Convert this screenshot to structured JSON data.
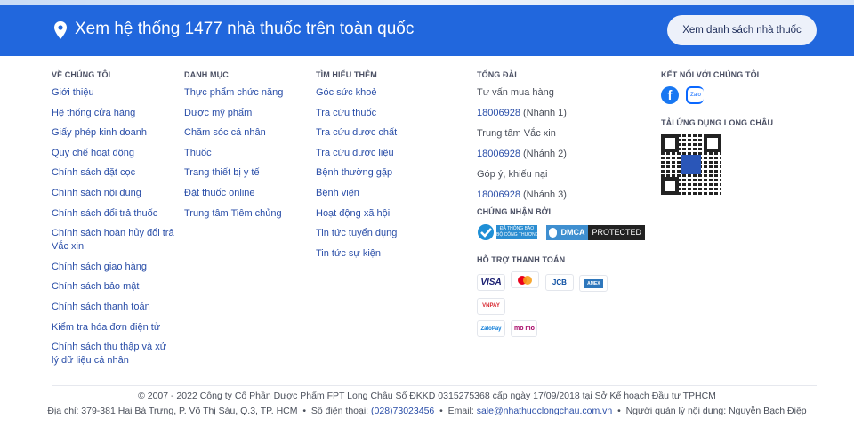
{
  "banner": {
    "title": "Xem hệ thống 1477 nhà thuốc trên toàn quốc",
    "button": "Xem danh sách nhà thuốc"
  },
  "col1": {
    "title": "Về chúng tôi",
    "items": [
      "Giới thiệu",
      "Hệ thống cửa hàng",
      "Giấy phép kinh doanh",
      "Quy chế hoạt động",
      "Chính sách đặt cọc",
      "Chính sách nội dung",
      "Chính sách đổi trả thuốc",
      "Chính sách hoàn hủy đổi trả Vắc xin",
      "Chính sách giao hàng",
      "Chính sách bảo mật",
      "Chính sách thanh toán",
      "Kiểm tra hóa đơn điện tử",
      "Chính sách thu thập và xử lý dữ liệu cá nhân"
    ]
  },
  "col2": {
    "title": "Danh mục",
    "items": [
      "Thực phẩm chức năng",
      "Dược mỹ phẩm",
      "Chăm sóc cá nhân",
      "Thuốc",
      "Trang thiết bị y tế",
      "Đặt thuốc online",
      "Trung tâm Tiêm chủng"
    ]
  },
  "col3": {
    "title": "Tìm hiểu thêm",
    "items": [
      "Góc sức khoẻ",
      "Tra cứu thuốc",
      "Tra cứu dược chất",
      "Tra cứu dược liệu",
      "Bệnh thường gặp",
      "Bệnh viện",
      "Hoạt động xã hội",
      "Tin tức tuyển dụng",
      "Tin tức sự kiện"
    ]
  },
  "col4": {
    "title": "Tổng đài",
    "groups": [
      {
        "label": "Tư vấn mua hàng",
        "phone": "18006928",
        "branch": "(Nhánh 1)"
      },
      {
        "label": "Trung tâm Vắc xin",
        "phone": "18006928",
        "branch": "(Nhánh 2)"
      },
      {
        "label": "Góp ý, khiếu nại",
        "phone": "18006928",
        "branch": "(Nhánh 3)"
      }
    ],
    "cert_title": "Chứng nhận bởi",
    "cert1": "ĐÃ THÔNG BÁO",
    "cert1_sub": "BỘ CÔNG THƯƠNG",
    "dmca": "DMCA",
    "dmca_protected": "PROTECTED",
    "pay_title": "Hỗ trợ thanh toán",
    "pay": [
      "VISA",
      "JCB",
      "AMEX",
      "VNPAY",
      "ZaloPay",
      "mo mo"
    ]
  },
  "col5": {
    "title": "Kết nối với chúng tôi",
    "zalo": "Zalo",
    "app_title": "Tải ứng dụng Long Châu"
  },
  "footer": {
    "copyright": "© 2007 - 2022 Công ty Cổ Phần Dược Phẩm FPT Long Châu Số ĐKKD 0315275368 cấp ngày 17/09/2018 tại Sở Kế hoạch Đầu tư TPHCM",
    "address": "Địa chỉ: 379-381 Hai Bà Trưng, P. Võ Thị Sáu, Q.3, TP. HCM",
    "phone_label": "Số điện thoại:",
    "phone": "(028)73023456",
    "email_label": "Email:",
    "email": "sale@nhathuoclongchau.com.vn",
    "manager": "Người quản lý nội dung: Nguyễn Bạch Điệp"
  }
}
